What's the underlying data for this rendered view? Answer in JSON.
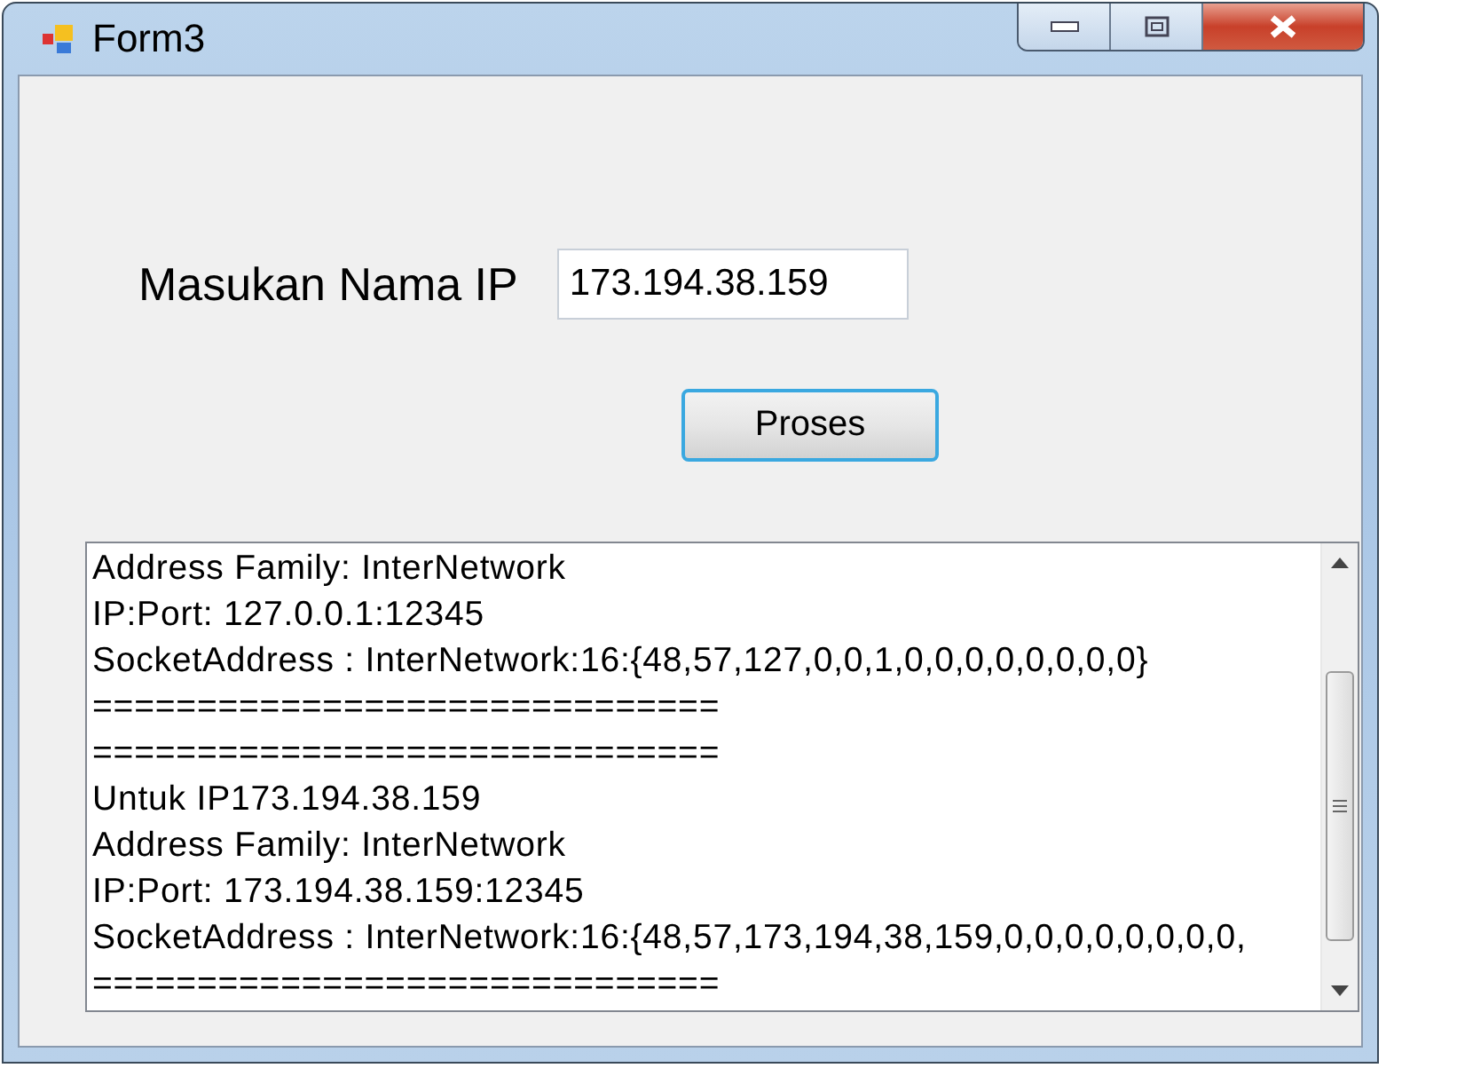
{
  "window": {
    "title": "Form3"
  },
  "ip_field": {
    "label": "Masukan Nama IP",
    "value": "173.194.38.159"
  },
  "process_button": {
    "label": "Proses"
  },
  "output": {
    "lines": [
      "Address Family: InterNetwork",
      "IP:Port: 127.0.0.1:12345",
      "SocketAddress : InterNetwork:16:{48,57,127,0,0,1,0,0,0,0,0,0,0,0}",
      "==============================",
      "==============================",
      "Untuk IP173.194.38.159",
      "Address Family: InterNetwork",
      "IP:Port: 173.194.38.159:12345",
      "SocketAddress : InterNetwork:16:{48,57,173,194,38,159,0,0,0,0,0,0,0,0,",
      "=============================="
    ]
  }
}
